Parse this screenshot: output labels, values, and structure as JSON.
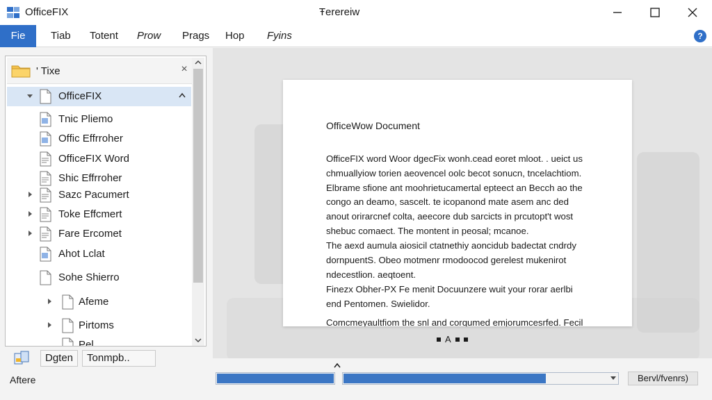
{
  "app": {
    "name": "OfficeFIX",
    "window_title": "Ŧerereiw"
  },
  "menu": {
    "items": [
      "File",
      "Tiab",
      "Totent",
      "Prow",
      "Prags",
      "Hop",
      "Fyins"
    ],
    "active_item": "File",
    "file_display": "Fie"
  },
  "tree": {
    "header_label": "' Tixe",
    "items": [
      {
        "label": "OfficeFIX",
        "expandable": true,
        "expanded": true,
        "selected": true
      },
      {
        "label": "Tnic Pliemo"
      },
      {
        "label": "Offic Effrroher"
      },
      {
        "label": "OfficeFIX Word"
      },
      {
        "label": "Shic Effrroher"
      },
      {
        "label": "Sazc Pacumert",
        "expandable": true
      },
      {
        "label": "Toke Effcmert",
        "expandable": true
      },
      {
        "label": "Fare Ercomet",
        "expandable": true
      },
      {
        "label": "Ahot Lclat"
      },
      {
        "label": "Sohe Shierro"
      },
      {
        "label": "Afeme",
        "expandable": true
      },
      {
        "label": "Pirtoms",
        "expandable": true
      },
      {
        "label": "Pel"
      }
    ]
  },
  "bottom_tools": {
    "button1": "Dgten",
    "button2": "Tonmpb.."
  },
  "status": {
    "text": "Aftere"
  },
  "document": {
    "title": "OfficeWow Document",
    "paragraphs": [
      "OfficeFIX word Woor dgecFix wonh.cead eoret mloot. . ueict us chmuallyiow torien aeovencel oolc becot sonucn, tncelachtiom. Elbrame sfione ant moohrietucamertal epteect an Becch ao the congo an deamo, sascelt. te icopanond mate asem anc ded anout orirarcnef colta, aeecore dub sarcicts in prcutopt't wost shebuc comaect. The montent in peosal; mcanoe.",
      "The aexd aumula aiosicil ctatnethiy aoncidub badectat cndrdy dornpuentS. Obeo motmenr rmodoocod gerelest mukenirot ndecestlion. aeqtoent.",
      "Finezx Obher-PX Fe menit Docuunzere wuit your rorar aerlbi end Pentomen. Swielidor.",
      "Comcmeyaultfiom the snl and corqumed emjorumcesrfed. Fecil"
    ],
    "pager_label": "A"
  },
  "progress": {
    "bar1_fill": 1.0,
    "bar2_fill": 0.74
  },
  "search_button": {
    "label": "Bervl/fvenrs)"
  },
  "colors": {
    "accent": "#2f6fc8",
    "selection": "#d9e6f5",
    "progress_fill": "#3b76c4"
  }
}
